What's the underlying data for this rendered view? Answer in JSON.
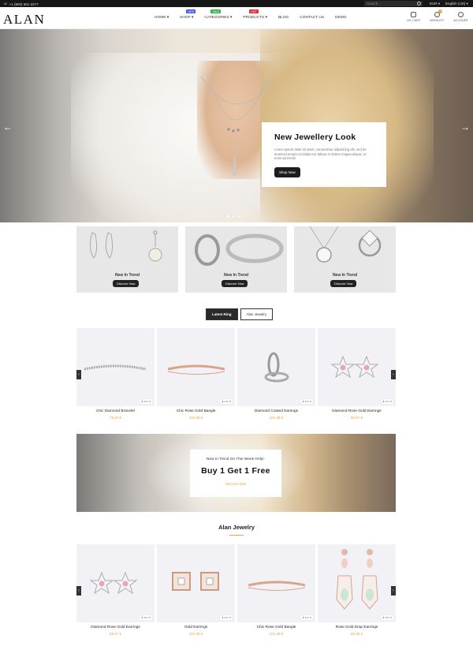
{
  "topbar": {
    "phone": "+1 (800) 691-3277",
    "search_placeholder": "Search...",
    "currency": "EUR",
    "language": "English (US)"
  },
  "header": {
    "logo": "ALAN",
    "nav": [
      {
        "label": "HOME",
        "badge": ""
      },
      {
        "label": "SHOP",
        "badge": "NEW"
      },
      {
        "label": "CATEGORIES",
        "badge": "SALE"
      },
      {
        "label": "PRODUCTS",
        "badge": "HOT"
      },
      {
        "label": "BLOG",
        "badge": ""
      },
      {
        "label": "CONTACT US",
        "badge": ""
      },
      {
        "label": "DEMO",
        "badge": ""
      }
    ],
    "icons": {
      "cart": "MY CART",
      "wishlist": "WISHLIST",
      "wishlist_count": "0",
      "account": "ACCOUNT"
    }
  },
  "hero": {
    "title": "New Jewellery Look",
    "text": "Lorem ipsum dolor sit amet, consectetur adipisicing elit, sed do eiusmod tempor incididunt ut labore et dolore magna aliqua. Ut enim ad minim",
    "button": "Shop Now"
  },
  "banners": [
    {
      "title": "New In Trend",
      "button": "Discover Now"
    },
    {
      "title": "New In Trend",
      "button": "Discover Now"
    },
    {
      "title": "New In Trend",
      "button": "Discover Now"
    }
  ],
  "tabs": [
    "Latest Ring",
    "Alan Jewelry"
  ],
  "products_row1": [
    {
      "name": "Chic Diamond Bracelet",
      "price": "79.22 €",
      "rating": "3.9 / 5"
    },
    {
      "name": "Chic Rose Gold Bangle",
      "price": "101.38 €",
      "rating": "3.9 / 5"
    },
    {
      "name": "Diamond Coated Earrings",
      "price": "101.38 €",
      "rating": "3.9 / 5"
    },
    {
      "name": "Diamond Rose Gold Earrings",
      "price": "55.97 €",
      "rating": "3.9 / 5"
    }
  ],
  "promo": {
    "subtitle": "New In Trend On This Week Only!-",
    "title": "Buy 1 Get 1 Free",
    "link": "Discover Now"
  },
  "section2_title": "Alan Jewelry",
  "products_row2": [
    {
      "name": "Diamond Rose Gold Earrings",
      "price": "55.97 €",
      "rating": "3.9 / 5"
    },
    {
      "name": "Gold Earrings",
      "price": "101.38 €",
      "rating": "3.9 / 5"
    },
    {
      "name": "Chic Rose Gold Bangle",
      "price": "101.38 €",
      "rating": "3.9 / 5"
    },
    {
      "name": "Rose Gold Drop Earrings",
      "price": "60.68 €",
      "rating": "3.9 / 5"
    }
  ],
  "colors": {
    "accent": "#e8a33d",
    "dark": "#1d1d1d"
  }
}
